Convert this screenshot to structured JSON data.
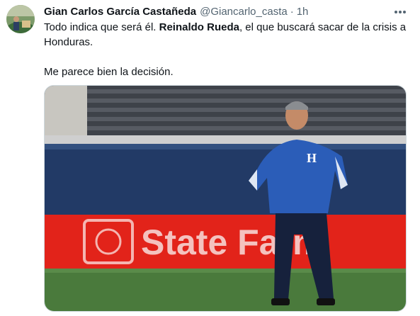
{
  "tweet": {
    "author_name": "Gian Carlos García Castañeda",
    "handle": "@Giancarlo_casta",
    "separator": "·",
    "time": "1h",
    "line1_pre": "Todo indica que será él. ",
    "line1_bold": "Reinaldo Rueda",
    "line1_post": ", el que buscará sacar de la crisis a Honduras.",
    "line2": "Me parece bien la decisión."
  },
  "media": {
    "banner_text": "State Farm",
    "jersey_letter": "H"
  },
  "icons": {
    "more": "more-horizontal-icon",
    "avatar": "avatar-photo"
  },
  "colors": {
    "text": "#0f1419",
    "secondary": "#536471",
    "banner_red": "#e2231a",
    "jersey_blue": "#2b5db8"
  }
}
